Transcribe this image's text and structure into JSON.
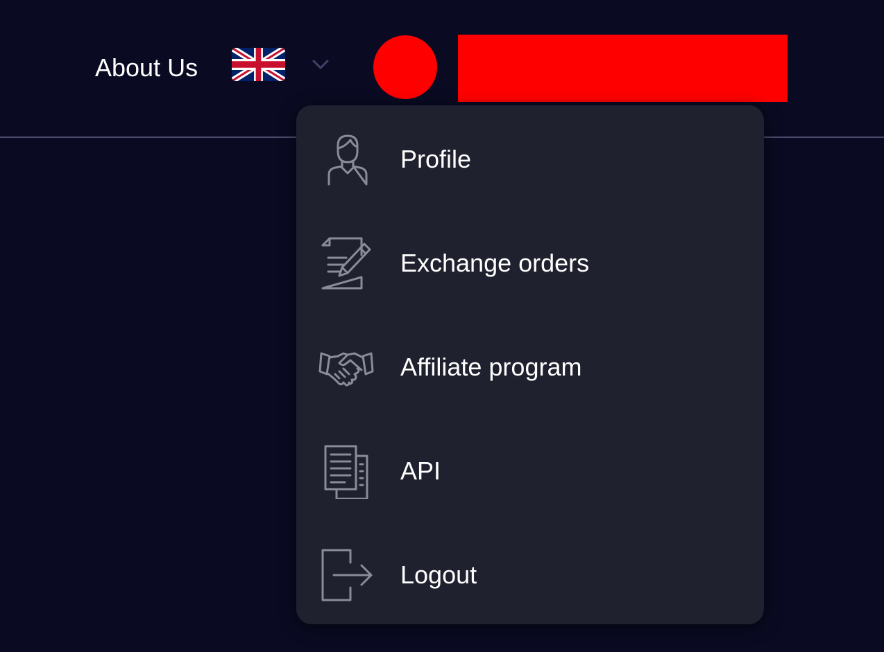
{
  "header": {
    "about_label": "About Us",
    "language_flag": "uk-flag-icon",
    "language_dropdown_icon": "chevron-down-icon",
    "avatar_color": "#ff0000",
    "username_redaction_color": "#ff0000"
  },
  "user_menu": {
    "items": [
      {
        "label": "Profile",
        "icon": "user-icon"
      },
      {
        "label": "Exchange orders",
        "icon": "document-edit-icon"
      },
      {
        "label": "Affiliate program",
        "icon": "handshake-icon"
      },
      {
        "label": "API",
        "icon": "documents-icon"
      },
      {
        "label": "Logout",
        "icon": "logout-icon"
      }
    ]
  },
  "colors": {
    "background": "#0a0a22",
    "menu_background": "#1f212e",
    "icon_stroke": "#8a8c98",
    "text": "#ffffff"
  }
}
